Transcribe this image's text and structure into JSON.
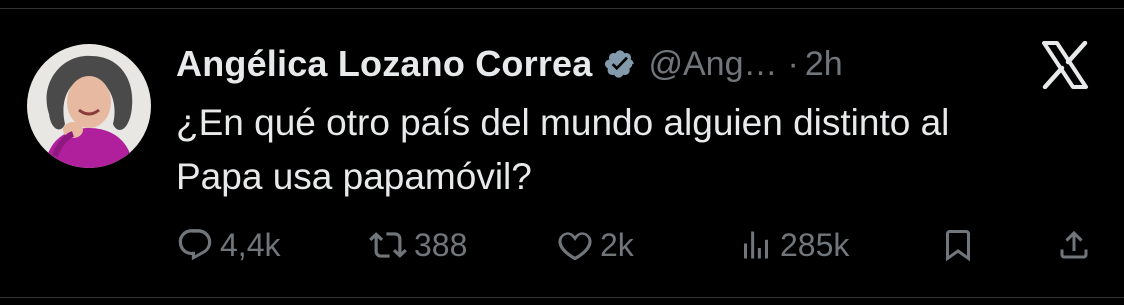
{
  "tweet": {
    "author_name": "Angélica Lozano Correa",
    "handle": "@Ang…",
    "separator": "·",
    "time": "2h",
    "verified": true,
    "text_lines": [
      "¿En qué otro país del mundo alguien distinto al",
      "Papa usa papamóvil?"
    ]
  },
  "actions": {
    "replies": "4,4k",
    "retweets": "388",
    "likes": "2k",
    "views": "285k"
  },
  "icons": {
    "reply": "reply-icon",
    "retweet": "retweet-icon",
    "like": "heart-icon",
    "views": "views-icon",
    "bookmark": "bookmark-icon",
    "share": "share-icon",
    "brand": "x-logo-icon",
    "verified": "verified-badge-icon"
  },
  "colors": {
    "background": "#000000",
    "text_primary": "#e7e9ea",
    "text_secondary": "#71767b",
    "verified_badge": "#829aab",
    "divider": "#2f3336"
  }
}
